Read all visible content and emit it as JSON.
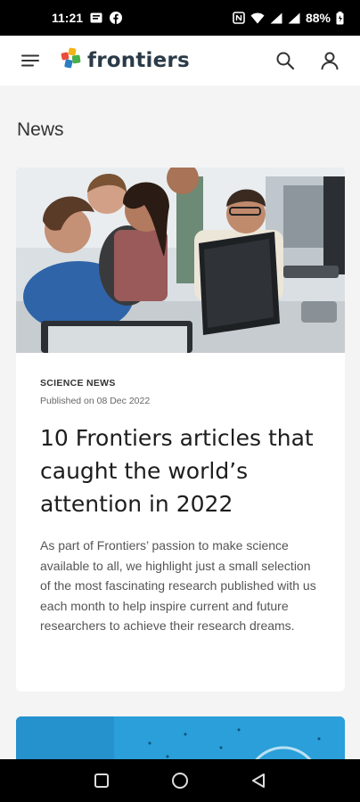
{
  "status_bar": {
    "time": "11:21",
    "battery": "88%",
    "icons": [
      "message-icon",
      "facebook-icon",
      "nfc-icon",
      "wifi-icon",
      "signal-icon",
      "signal-icon",
      "battery-icon"
    ]
  },
  "app_bar": {
    "logo_text": "frontiers",
    "menu_icon": "hamburger-menu-icon",
    "search_icon": "search-icon",
    "account_icon": "user-icon"
  },
  "main": {
    "section_title": "News",
    "article": {
      "category": "SCIENCE NEWS",
      "published": "Published on 08 Dec 2022",
      "headline": "10 Frontiers articles that caught the world’s attention in 2022",
      "excerpt": "As part of Frontiers’ passion to make science available to all, we highlight just a small selection of the most fascinating research published with us each month to help inspire current and future researchers to achieve their research dreams."
    }
  },
  "nav_bar": {
    "icons": [
      "recents-square-icon",
      "home-circle-icon",
      "back-triangle-icon"
    ]
  },
  "colors": {
    "brand_text": "#2b3a48",
    "page_bg": "#f4f4f4",
    "card_bg": "#ffffff",
    "second_card": "#2a9fd9"
  }
}
